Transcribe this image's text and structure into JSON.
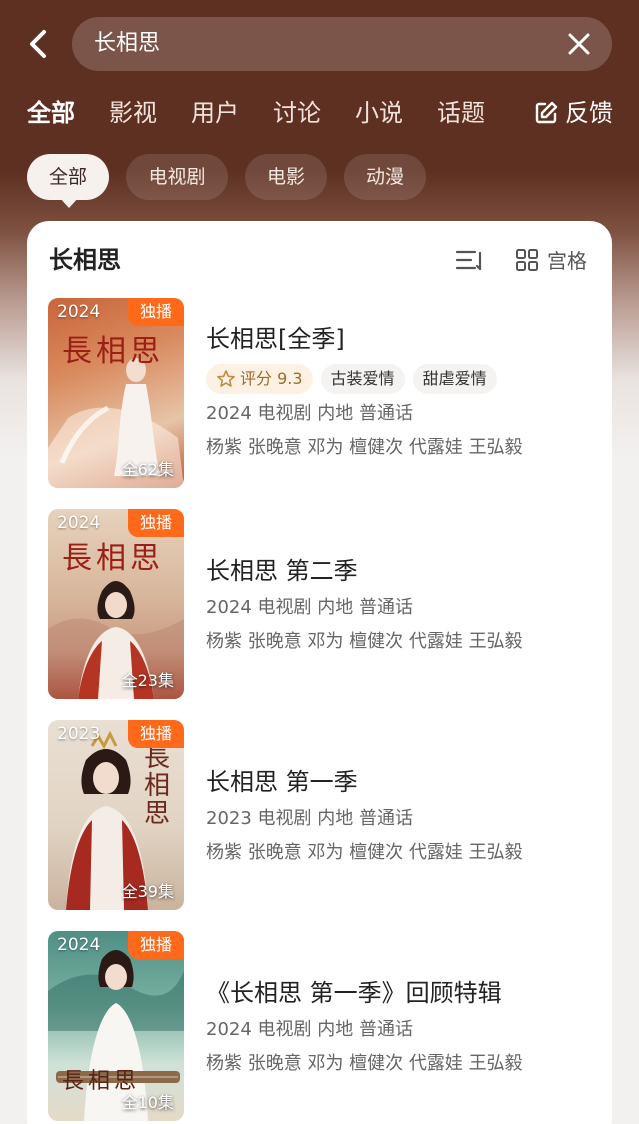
{
  "search": {
    "query": "长相思"
  },
  "tabs": [
    {
      "label": "全部"
    },
    {
      "label": "影视"
    },
    {
      "label": "用户"
    },
    {
      "label": "讨论"
    },
    {
      "label": "小说"
    },
    {
      "label": "话题"
    }
  ],
  "feedback_label": "反馈",
  "chips": [
    {
      "label": "全部"
    },
    {
      "label": "电视剧"
    },
    {
      "label": "电影"
    },
    {
      "label": "动漫"
    }
  ],
  "card": {
    "title": "长相思",
    "grid_label": "宫格"
  },
  "colors": {
    "header_bg": "#5e3021",
    "badge": "#ff6a1a",
    "score_bg": "#fcf1e3"
  },
  "results": [
    {
      "year": "2024",
      "badge": "独播",
      "episodes": "全62集",
      "title": "长相思[全季]",
      "score": "评分 9.3",
      "tags": [
        "古装爱情",
        "甜虐爱情"
      ],
      "meta": "2024 电视剧 内地 普通话",
      "cast": "杨紫 张晚意 邓为 檀健次 代露娃 王弘毅"
    },
    {
      "year": "2024",
      "badge": "独播",
      "episodes": "全23集",
      "title": "长相思 第二季",
      "meta": "2024 电视剧 内地 普通话",
      "cast": "杨紫 张晚意 邓为 檀健次 代露娃 王弘毅"
    },
    {
      "year": "2023",
      "badge": "独播",
      "episodes": "全39集",
      "title": "长相思 第一季",
      "meta": "2023 电视剧 内地 普通话",
      "cast": "杨紫 张晚意 邓为 檀健次 代露娃 王弘毅"
    },
    {
      "year": "2024",
      "badge": "独播",
      "episodes": "全10集",
      "title": "《长相思 第一季》回顾特辑",
      "meta": "2024 电视剧 内地 普通话",
      "cast": "杨紫 张晚意 邓为 檀健次 代露娃 王弘毅"
    }
  ]
}
